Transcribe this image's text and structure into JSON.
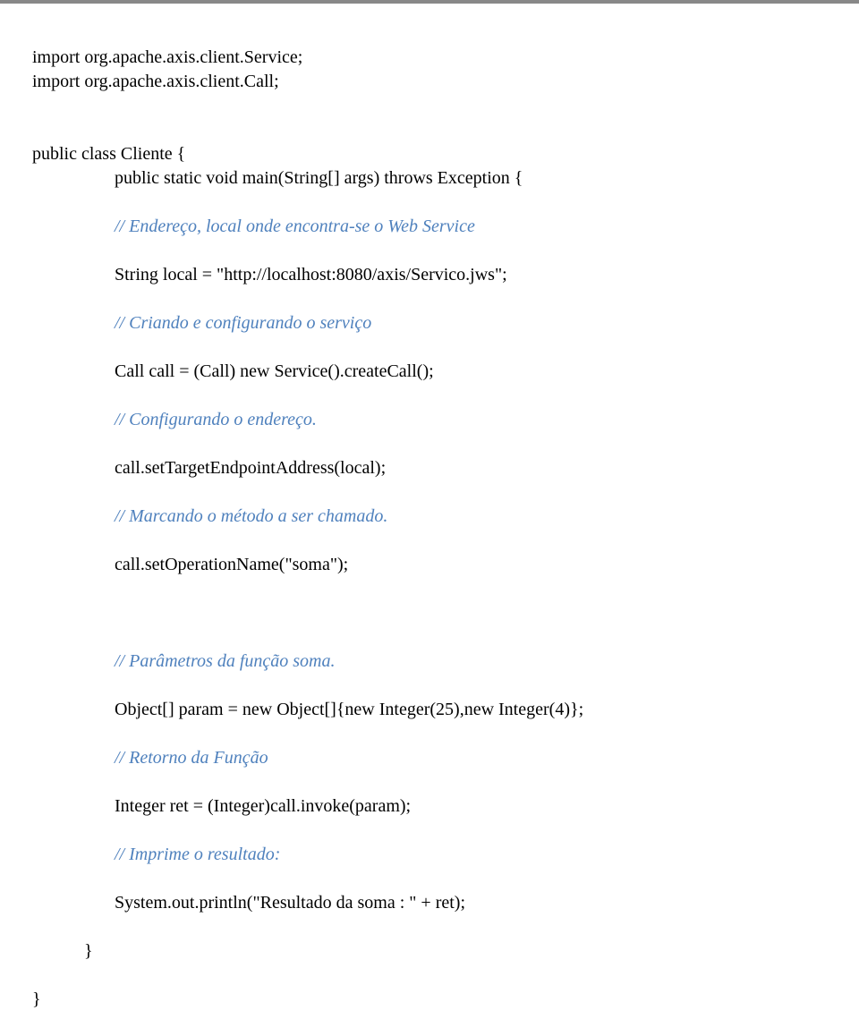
{
  "code": {
    "l1": "import org.apache.axis.client.Service;",
    "l2": "import org.apache.axis.client.Call;",
    "l3": "public class Cliente {",
    "l4a": "public static void main(String[] args) throws Exception {",
    "c1": "// Endereço, local onde encontra-se o Web Service",
    "l5": "String local = \"http://localhost:8080/axis/Servico.jws\";",
    "c2": "// Criando e configurando o serviço",
    "l6": "Call call = (Call) new Service().createCall();",
    "c3": "// Configurando o endereço.",
    "l7": "call.setTargetEndpointAddress(local);",
    "c4": "// Marcando o método a ser chamado.",
    "l8": "call.setOperationName(\"soma\");",
    "c5": "// Parâmetros da função soma.",
    "l9": "Object[] param = new Object[]{new Integer(25),new Integer(4)};",
    "c6": "// Retorno da Função",
    "l10": "Integer ret = (Integer)call.invoke(param);",
    "c7": "// Imprime o resultado:",
    "l11": "System.out.println(\"Resultado da soma : \" + ret);",
    "l12": "}",
    "l13": "}"
  }
}
